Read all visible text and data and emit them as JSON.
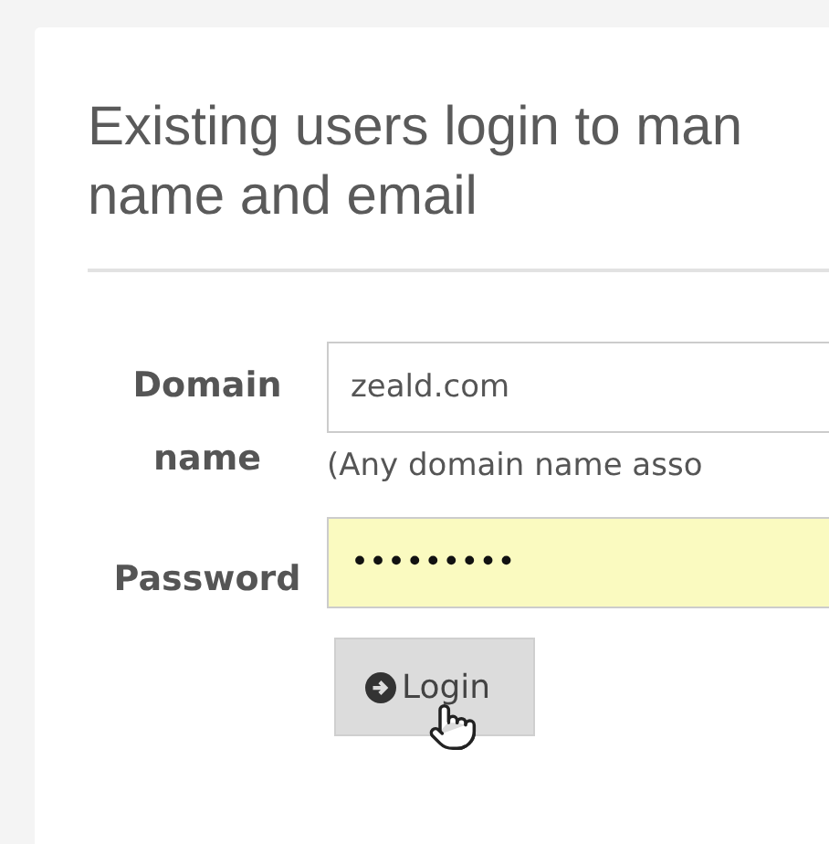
{
  "heading": {
    "lines": [
      "Existing users login to man",
      "name and email"
    ]
  },
  "fields": [
    {
      "label_lines": [
        "Domain",
        "name"
      ],
      "value": "zeald.com",
      "hint": "(Any domain name asso",
      "autofilled": false
    },
    {
      "label_lines": [
        "Password"
      ],
      "value": "•••••••••",
      "autofilled": true
    }
  ],
  "button": {
    "label": "Login"
  }
}
